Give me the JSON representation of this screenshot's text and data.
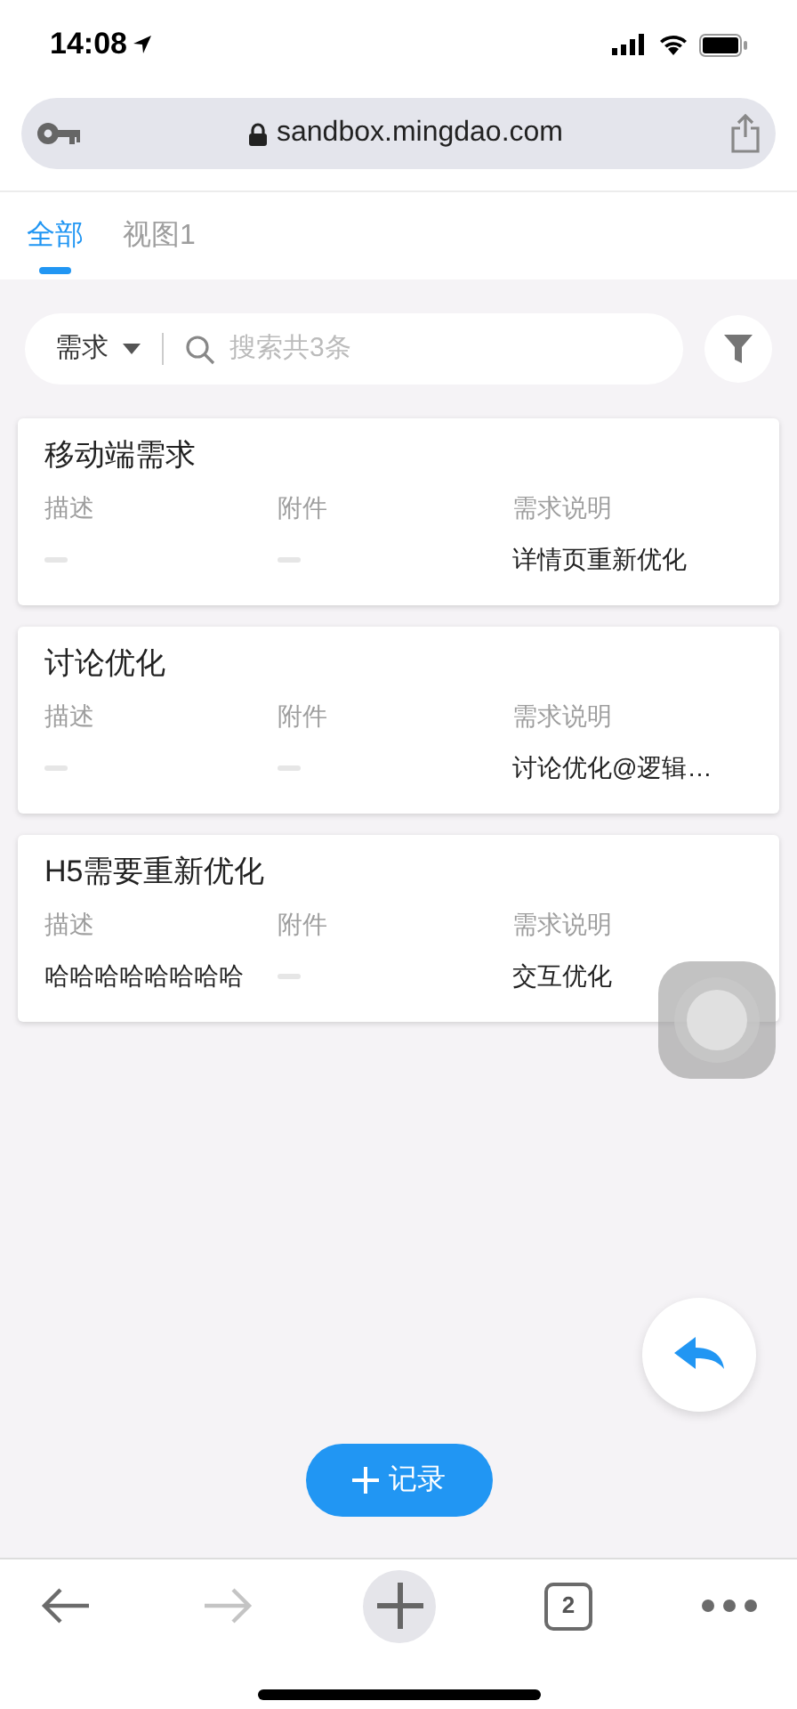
{
  "status_bar": {
    "time": "14:08"
  },
  "address_bar": {
    "url": "sandbox.mingdao.com"
  },
  "tabs": [
    {
      "label": "全部",
      "selected": true
    },
    {
      "label": "视图1",
      "selected": false
    }
  ],
  "search": {
    "field_selector": "需求",
    "placeholder": "搜索共3条"
  },
  "records": [
    {
      "title": "移动端需求",
      "fields": [
        {
          "label": "描述"
        },
        {
          "label": "附件"
        },
        {
          "label": "需求说明",
          "value": "详情页重新优化"
        }
      ]
    },
    {
      "title": "讨论优化",
      "fields": [
        {
          "label": "描述"
        },
        {
          "label": "附件"
        },
        {
          "label": "需求说明",
          "value": "讨论优化@逻辑…"
        }
      ]
    },
    {
      "title": "H5需要重新优化",
      "fields": [
        {
          "label": "描述",
          "value": "哈哈哈哈哈哈哈哈"
        },
        {
          "label": "附件"
        },
        {
          "label": "需求说明",
          "value": "交互优化"
        }
      ]
    }
  ],
  "add_button": {
    "label": "记录"
  },
  "browser_toolbar": {
    "forward_disabled": true,
    "tab_count": "2"
  }
}
